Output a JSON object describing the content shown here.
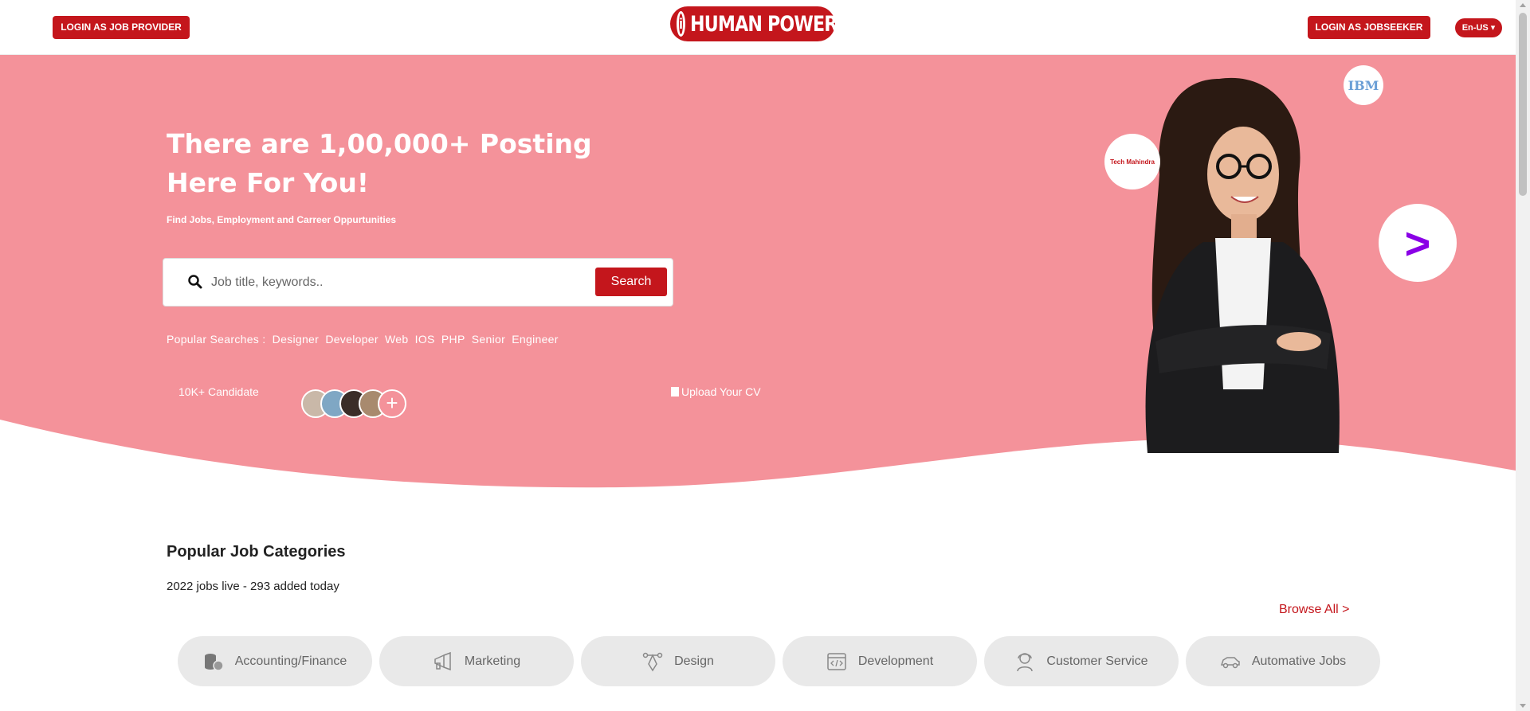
{
  "header": {
    "provider_login": "LOGIN AS JOB PROVIDER",
    "logo_text": "HUMAN POWER",
    "logo_mark": "i",
    "seeker_login": "LOGIN AS JOBSEEKER",
    "language": "En-US ▾"
  },
  "hero": {
    "title": "There are 1,00,000+ Posting Here For You!",
    "subtitle": "Find Jobs, Employment and Carreer Oppurtunities",
    "search": {
      "placeholder": "Job title, keywords..",
      "button": "Search"
    },
    "popular_label": "Popular Searches :",
    "popular_terms": [
      "Designer",
      "Developer",
      "Web",
      "IOS",
      "PHP",
      "Senior",
      "Engineer"
    ],
    "candidates": "10K+ Candidate",
    "upload_cv": "Upload Your CV",
    "brands": {
      "ibm": "IBM",
      "tech_mahindra": "Tech Mahindra",
      "accenture": ">"
    }
  },
  "categories": {
    "title": "Popular Job Categories",
    "live": "2022 jobs live - 293 added today",
    "browse_all": "Browse All >",
    "items": [
      {
        "label": "Accounting/Finance",
        "icon": "coins-icon"
      },
      {
        "label": "Marketing",
        "icon": "megaphone-icon"
      },
      {
        "label": "Design",
        "icon": "pen-tool-icon"
      },
      {
        "label": "Development",
        "icon": "code-window-icon"
      },
      {
        "label": "Customer Service",
        "icon": "headset-agent-icon"
      },
      {
        "label": "Automative Jobs",
        "icon": "car-icon"
      }
    ]
  },
  "colors": {
    "brand_red": "#c4161c",
    "hero_pink": "#f4929a",
    "category_bg": "#e9e9e9"
  }
}
